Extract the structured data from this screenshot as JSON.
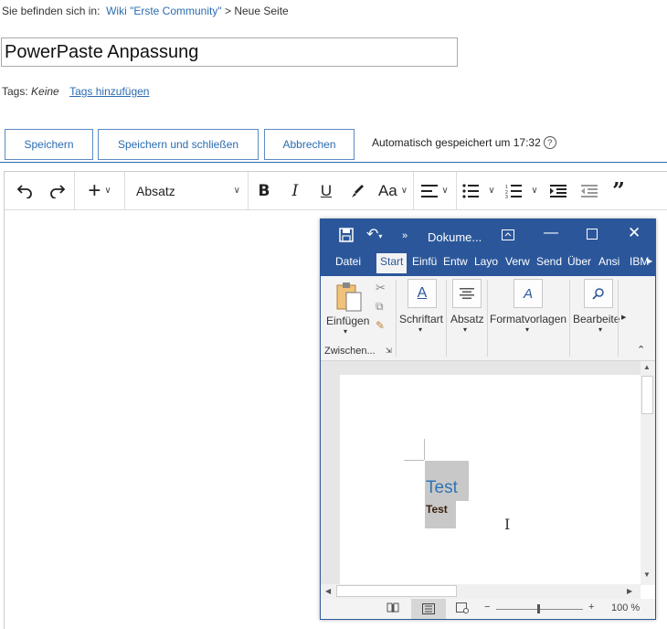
{
  "breadcrumb": {
    "prefix": "Sie befinden sich in:",
    "link": "Wiki \"Erste Community\"",
    "separator": ">",
    "current": "Neue Seite"
  },
  "page_title_value": "PowerPaste Anpassung",
  "tags": {
    "label": "Tags:",
    "value": "Keine",
    "add_link": "Tags hinzufügen"
  },
  "actions": {
    "save": "Speichern",
    "save_close": "Speichern und schließen",
    "cancel": "Abbrechen",
    "autosave": "Automatisch gespeichert um 17:32",
    "help_icon": "question-circle-icon"
  },
  "toolbar": {
    "paragraph_style": "Absatz",
    "icons": [
      "undo-icon",
      "redo-icon",
      "insert-plus-icon",
      "bold-icon",
      "italic-icon",
      "underline-icon",
      "highlight-brush-icon",
      "font-size-icon",
      "align-left-icon",
      "bullet-list-icon",
      "numbered-list-icon",
      "indent-icon",
      "outdent-icon",
      "blockquote-icon"
    ]
  },
  "word": {
    "title": "Dokume...",
    "tabs": [
      "Datei",
      "Start",
      "Einfü",
      "Entw",
      "Layo",
      "Verw",
      "Send",
      "Über",
      "Ansi",
      "IBM"
    ],
    "active_tab": "Start",
    "ribbon": {
      "paste": "Einfügen",
      "clipboard_group": "Zwischen...",
      "font": "Schriftart",
      "paragraph": "Absatz",
      "styles": "Formatvorlagen",
      "editing": "Bearbeite"
    },
    "doc": {
      "heading": "Test",
      "body": "Test"
    },
    "status": {
      "zoom": "100 %",
      "zoom_minus": "−",
      "zoom_plus": "+"
    }
  },
  "colors": {
    "word_blue": "#2b579a",
    "link_blue": "#2b6cb0",
    "heading_blue": "#2e74b5"
  }
}
